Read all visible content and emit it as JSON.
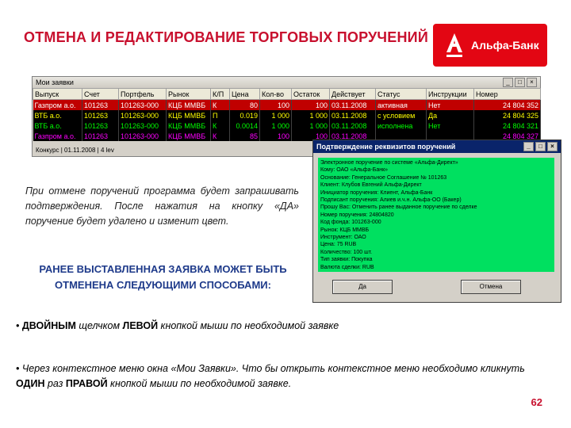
{
  "title": "ОТМЕНА И РЕДАКТИРОВАНИЕ ТОРГОВЫХ ПОРУЧЕНИЙ",
  "logo": {
    "text": "Альфа-Банк",
    "color": "#e30613"
  },
  "window": {
    "title": "Мои заявки",
    "controls": [
      "_",
      "□",
      "×"
    ],
    "columns": [
      "Выпуск",
      "Счет",
      "Портфель",
      "Рынок",
      "К/П",
      "Цена",
      "Кол-во",
      "Остаток",
      "Действует",
      "Статус",
      "Инструкции",
      "Номер"
    ],
    "rows": [
      [
        "Газпром а.о.",
        "101263",
        "101263-000",
        "КЦБ ММВБ",
        "К",
        "80",
        "100",
        "100",
        "03.11.2008",
        "активная",
        "Нет",
        "24 804 352"
      ],
      [
        "ВТБ а.о.",
        "101263",
        "101263-000",
        "КЦБ ММВБ",
        "П",
        "0.019",
        "1 000",
        "1 000",
        "03.11.2008",
        "с условием",
        "Да",
        "24 804 325"
      ],
      [
        "ВТБ а.о.",
        "101263",
        "101263-000",
        "КЦБ ММВБ",
        "К",
        "0.0014",
        "1 000",
        "1 000",
        "03.11.2008",
        "исполнена",
        "Нет",
        "24 804 321"
      ],
      [
        "Газпром а.о.",
        "101263",
        "101263-000",
        "КЦБ ММВБ",
        "К",
        "85",
        "100",
        "100",
        "03.11.2008",
        "",
        "",
        "24 804 327"
      ]
    ],
    "status_bar": "Конкурс | 01.11.2008 | 4 lev"
  },
  "dialog": {
    "title": "Подтверждение реквизитов поручений",
    "controls": [
      "_",
      "□",
      "×"
    ],
    "lines": [
      "Электронное поручение по системе «Альфа-Директ»",
      "Кому: ОАО «Альфа-Банк»",
      "Основание: Генеральное Соглашение № 101263",
      "Клиент: Клубов Евгений Альфа-Директ",
      "Инициатор поручения: Клиент, Альфа-Банк",
      "Подписант поручения: Алиев и.ч.н. Альфа-ОО (Бакер)",
      "Прошу Вас: Отменить ранее выданное поручение по сделке",
      "Номер поручения: 24804820",
      "Код фонда: 101263-000",
      "Рынок: КЦБ ММВБ",
      "Инструмент: ОАО",
      "Цена: 75 RUB",
      "Количество: 100 шт.",
      "Тип заявки: Покупка",
      "Валюта сделки: RUB"
    ],
    "ok_label": "Да",
    "cancel_label": "Отмена"
  },
  "paragraph": "При отмене поручений программа будет запрашивать подтверждения. После нажатия на кнопку «ДА» поручение будет удалено и изменит цвет.",
  "heading": "РАНЕЕ ВЫСТАВЛЕННАЯ ЗАЯВКА МОЖЕТ БЫТЬ ОТМЕНЕНА СЛЕДУЮЩИМИ СПОСОБАМИ:",
  "bullets": [
    {
      "marker": "•",
      "lead": "ДВОЙНЫМ",
      "mid1": " щелчком ",
      "bold2": "ЛЕВОЙ",
      "rest": " кнопкой мыши по необходимой заявке"
    },
    {
      "marker": "•",
      "lead": "",
      "mid1": " Через контекстное меню окна «Мои Заявки». Что бы открыть контекстное меню необходимо кликнуть ",
      "bold2": "ОДИН",
      "mid2": " раз ",
      "bold3": "ПРАВОЙ",
      "rest": " кнопкой мыши по необходимой заявке."
    }
  ],
  "page_number": "62"
}
